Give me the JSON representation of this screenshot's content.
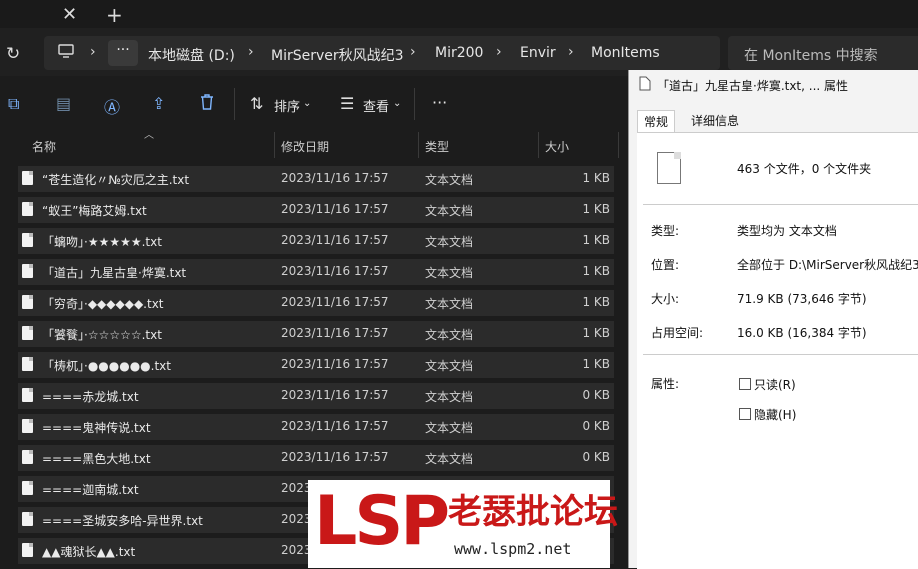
{
  "tabs": {
    "close_glyph": "✕",
    "new_tab_glyph": "+"
  },
  "address": {
    "more": "···",
    "crumbs": [
      "本地磁盘 (D:)",
      "MirServer秋风战纪3",
      "Mir200",
      "Envir",
      "MonItems"
    ],
    "search_placeholder": "在 MonItems 中搜索"
  },
  "toolbar": {
    "sort_label": "排序",
    "view_label": "查看",
    "more": "···"
  },
  "columns": {
    "name": "名称",
    "date": "修改日期",
    "type": "类型",
    "size": "大小"
  },
  "files": [
    {
      "name": "“苍生造化〃№灾厄之主.txt",
      "date": "2023/11/16 17:57",
      "type": "文本文档",
      "size": "1 KB"
    },
    {
      "name": "“蚁王”梅路艾姆.txt",
      "date": "2023/11/16 17:57",
      "type": "文本文档",
      "size": "1 KB"
    },
    {
      "name": "「螭吻」·★★★★★.txt",
      "date": "2023/11/16 17:57",
      "type": "文本文档",
      "size": "1 KB"
    },
    {
      "name": "「道古」九星古皇·烨寞.txt",
      "date": "2023/11/16 17:57",
      "type": "文本文档",
      "size": "1 KB"
    },
    {
      "name": "「穷奇」·◆◆◆◆◆◆.txt",
      "date": "2023/11/16 17:57",
      "type": "文本文档",
      "size": "1 KB"
    },
    {
      "name": "「饕餮」·☆☆☆☆☆.txt",
      "date": "2023/11/16 17:57",
      "type": "文本文档",
      "size": "1 KB"
    },
    {
      "name": "「梼杌」·●●●●●●.txt",
      "date": "2023/11/16 17:57",
      "type": "文本文档",
      "size": "1 KB"
    },
    {
      "name": "====赤龙城.txt",
      "date": "2023/11/16 17:57",
      "type": "文本文档",
      "size": "0 KB"
    },
    {
      "name": "====鬼神传说.txt",
      "date": "2023/11/16 17:57",
      "type": "文本文档",
      "size": "0 KB"
    },
    {
      "name": "====黑色大地.txt",
      "date": "2023/11/16 17:57",
      "type": "文本文档",
      "size": "0 KB"
    },
    {
      "name": "====迦南城.txt",
      "date": "2023",
      "type": "",
      "size": ""
    },
    {
      "name": "====圣城安多哈-异世界.txt",
      "date": "2023",
      "type": "",
      "size": ""
    },
    {
      "name": "▲▲魂狱长▲▲.txt",
      "date": "2023",
      "type": "",
      "size": ""
    }
  ],
  "props": {
    "title": "「道古」九星古皇·烨寞.txt, ... 属性",
    "tab_general": "常规",
    "tab_details": "详细信息",
    "count": "463 个文件，0 个文件夹",
    "type_label": "类型:",
    "type_value": "类型均为 文本文档",
    "location_label": "位置:",
    "location_value": "全部位于 D:\\MirServer秋风战纪3",
    "size_label": "大小:",
    "size_value": "71.9 KB (73,646 字节)",
    "disk_label": "占用空间:",
    "disk_value": "16.0 KB (16,384 字节)",
    "attr_label": "属性:",
    "readonly": "只读(R)",
    "hidden": "隐藏(H)"
  },
  "watermark": {
    "logo": "LSP",
    "name": "老瑟批论坛",
    "url": "www.lspm2.net"
  }
}
